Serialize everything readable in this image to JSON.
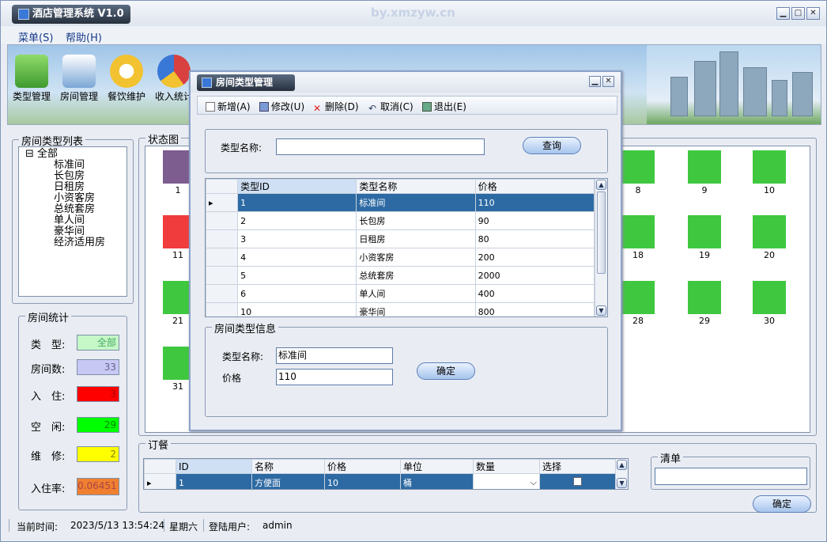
{
  "app": {
    "title": "酒店管理系统 V1.0",
    "watermark": "by.xmzyw.cn"
  },
  "menu": [
    {
      "label": "菜单(S)"
    },
    {
      "label": "帮助(H)"
    }
  ],
  "toolbar": {
    "buttons": [
      {
        "label": "类型管理",
        "icon": "house-icon",
        "color": "#4caf50"
      },
      {
        "label": "房间管理",
        "icon": "notepad-icon",
        "color": "#e0a030"
      },
      {
        "label": "餐饮维护",
        "icon": "clock-icon",
        "color": "#f2c230"
      },
      {
        "label": "收入统计",
        "icon": "pie-chart-icon",
        "color": "#d94040"
      }
    ]
  },
  "left": {
    "tree_title": "房间类型列表",
    "tree_root": "全部",
    "tree_items": [
      "标准间",
      "长包房",
      "日租房",
      "小资客房",
      "总统套房",
      "单人间",
      "豪华间",
      "经济适用房"
    ],
    "stats_title": "房间统计",
    "stats": [
      {
        "label": "类　型:",
        "value": "全部",
        "bg": "#c6f7c6"
      },
      {
        "label": "房间数:",
        "value": "33",
        "bg": "#c8c8f5"
      },
      {
        "label": "入　住:",
        "value": "3",
        "bg": "#ff0000"
      },
      {
        "label": "空　闲:",
        "value": "29",
        "bg": "#00ff00"
      },
      {
        "label": "维　修:",
        "value": "2",
        "bg": "#ffff00"
      },
      {
        "label": "入住率:",
        "value": "0.06451",
        "bg": "#f08030"
      }
    ]
  },
  "statemap": {
    "title": "状态图",
    "rooms": [
      {
        "num": "1",
        "color": "#7d5c8f"
      },
      {
        "num": "8",
        "color": "#3fc83f"
      },
      {
        "num": "9",
        "color": "#3fc83f"
      },
      {
        "num": "10",
        "color": "#3fc83f"
      },
      {
        "num": "11",
        "color": "#f03c3c"
      },
      {
        "num": "18",
        "color": "#3fc83f"
      },
      {
        "num": "19",
        "color": "#3fc83f"
      },
      {
        "num": "20",
        "color": "#3fc83f"
      },
      {
        "num": "21",
        "color": "#3fc83f"
      },
      {
        "num": "28",
        "color": "#3fc83f"
      },
      {
        "num": "29",
        "color": "#3fc83f"
      },
      {
        "num": "30",
        "color": "#3fc83f"
      },
      {
        "num": "31",
        "color": "#3fc83f"
      }
    ]
  },
  "dialog": {
    "title": "房间类型管理",
    "toolbar": [
      "新增(A)",
      "修改(U)",
      "删除(D)",
      "取消(C)",
      "退出(E)"
    ],
    "search_label": "类型名称:",
    "search_value": "",
    "search_button": "查询",
    "grid_headers": [
      "类型ID",
      "类型名称",
      "价格"
    ],
    "grid_rows": [
      {
        "id": "1",
        "name": "标准间",
        "price": "110"
      },
      {
        "id": "2",
        "name": "长包房",
        "price": "90"
      },
      {
        "id": "3",
        "name": "日租房",
        "price": "80"
      },
      {
        "id": "4",
        "name": "小资客房",
        "price": "200"
      },
      {
        "id": "5",
        "name": "总统套房",
        "price": "2000"
      },
      {
        "id": "6",
        "name": "单人间",
        "price": "400"
      },
      {
        "id": "10",
        "name": "豪华间",
        "price": "800"
      }
    ],
    "info_title": "房间类型信息",
    "name_label": "类型名称:",
    "name_value": "标准间",
    "price_label": "价格",
    "price_value": "110",
    "confirm": "确定"
  },
  "order": {
    "title": "订餐",
    "headers": [
      "ID",
      "名称",
      "价格",
      "单位",
      "数量",
      "选择"
    ],
    "row": {
      "id": "1",
      "name": "方便面",
      "price": "10",
      "unit": "桶",
      "qty": ""
    },
    "list_title": "清单",
    "confirm": "确定"
  },
  "status": {
    "time_label": "当前时间:",
    "time": "2023/5/13 13:54:24",
    "weekday": "星期六",
    "user_label": "登陆用户:",
    "user": "admin"
  }
}
